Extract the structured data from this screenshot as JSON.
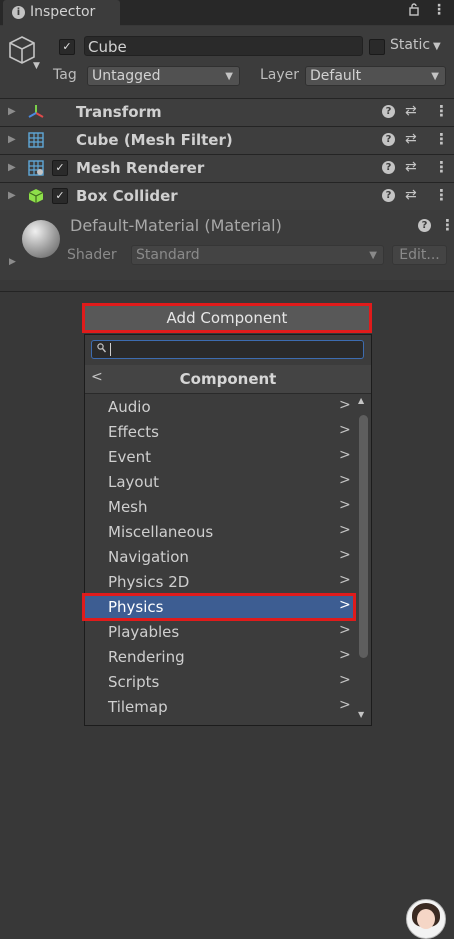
{
  "tab": {
    "label": "Inspector",
    "info_glyph": "i",
    "lock_glyph": "🔓",
    "menu_glyph": "⋮"
  },
  "object": {
    "name": "Cube",
    "active": true,
    "static_label": "Static",
    "static_checked": false,
    "tag_label": "Tag",
    "tag_value": "Untagged",
    "layer_label": "Layer",
    "layer_value": "Default"
  },
  "components": [
    {
      "name": "Transform",
      "icon": "transform-icon",
      "has_checkbox": false
    },
    {
      "name": "Cube (Mesh Filter)",
      "icon": "mesh-filter-icon",
      "has_checkbox": false
    },
    {
      "name": "Mesh Renderer",
      "icon": "mesh-renderer-icon",
      "has_checkbox": true
    },
    {
      "name": "Box Collider",
      "icon": "box-collider-icon",
      "has_checkbox": true
    }
  ],
  "component_glyphs": {
    "help": "?",
    "presets": "⇄",
    "menu": "⋮",
    "foldout": "▶",
    "check": "✓"
  },
  "material": {
    "name": "Default-Material (Material)",
    "shader_label": "Shader",
    "shader_value": "Standard",
    "edit_label": "Edit..."
  },
  "add_component": {
    "button_label": "Add Component",
    "search_value": "",
    "title": "Component",
    "back_glyph": "<",
    "items": [
      "Audio",
      "Effects",
      "Event",
      "Layout",
      "Mesh",
      "Miscellaneous",
      "Navigation",
      "Physics 2D",
      "Physics",
      "Playables",
      "Rendering",
      "Scripts",
      "Tilemap"
    ],
    "selected": "Physics",
    "item_glyph": ">"
  },
  "colors": {
    "background": "#383838",
    "selection": "#3d5d92",
    "highlight_outline": "#e01b1b",
    "search_focus": "#3d6cb0"
  }
}
